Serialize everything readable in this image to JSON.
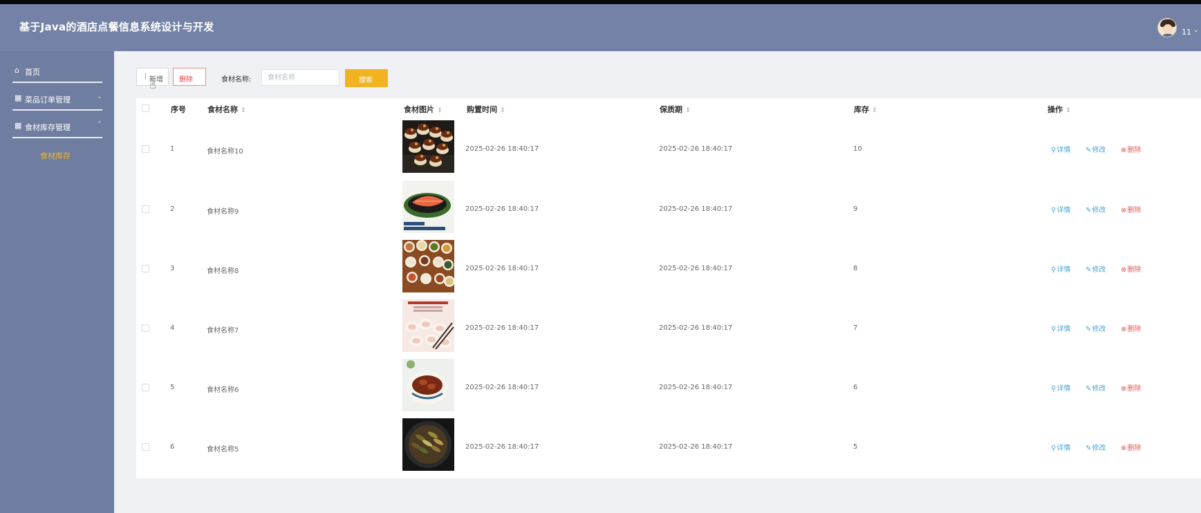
{
  "app": {
    "title": "基于Java的酒店点餐信息系统设计与开发",
    "user_name": "11",
    "user_caret": "⌄"
  },
  "sidebar": {
    "items": [
      {
        "label": "首页",
        "icon": "home-icon",
        "glyph": "⌂"
      },
      {
        "label": "菜品订单管理",
        "icon": "grid-icon",
        "glyph": "▦",
        "chevron": "⌄"
      },
      {
        "label": "食材库存管理",
        "icon": "grid-icon",
        "glyph": "▦",
        "chevron": "⌃"
      }
    ],
    "sub_items": [
      {
        "label": "食材库存",
        "active_color": "#f0b429"
      }
    ]
  },
  "toolbar": {
    "add_label": "新增",
    "delete_label": "删除",
    "search_label": "食材名称:",
    "search_placeholder": "食材名称",
    "search_value": "",
    "search_button": "搜索"
  },
  "table": {
    "columns": [
      "序号",
      "食材名称",
      "食材图片",
      "购置时间",
      "保质期",
      "库存",
      "操作"
    ],
    "sort_glyph": "⇕",
    "actions": {
      "detail": "详情",
      "edit": "修改",
      "remove": "删除"
    },
    "rows": [
      {
        "no": "1",
        "name": "食材名称10",
        "image": "dish-tartlets",
        "purchase_time": "2025-02-26 18:40:17",
        "shelf_life": "2025-02-26 18:40:17",
        "stock": "10"
      },
      {
        "no": "2",
        "name": "食材名称9",
        "image": "dish-salmon",
        "purchase_time": "2025-02-26 18:40:17",
        "shelf_life": "2025-02-26 18:40:17",
        "stock": "9"
      },
      {
        "no": "3",
        "name": "食材名称8",
        "image": "dish-banquet",
        "purchase_time": "2025-02-26 18:40:17",
        "shelf_life": "2025-02-26 18:40:17",
        "stock": "8"
      },
      {
        "no": "4",
        "name": "食材名称7",
        "image": "dish-dumplings",
        "purchase_time": "2025-02-26 18:40:17",
        "shelf_life": "2025-02-26 18:40:17",
        "stock": "7"
      },
      {
        "no": "5",
        "name": "食材名称6",
        "image": "dish-braised-pork",
        "purchase_time": "2025-02-26 18:40:17",
        "shelf_life": "2025-02-26 18:40:17",
        "stock": "6"
      },
      {
        "no": "6",
        "name": "食材名称5",
        "image": "dish-stirfry",
        "purchase_time": "2025-02-26 18:40:17",
        "shelf_life": "2025-02-26 18:40:17",
        "stock": "5"
      }
    ]
  },
  "colors": {
    "header_bg": "#7382a6",
    "sidebar_bg": "#6f7ea0",
    "accent": "#f2b320",
    "danger": "#e24a4a",
    "link": "#4aa5d9"
  }
}
